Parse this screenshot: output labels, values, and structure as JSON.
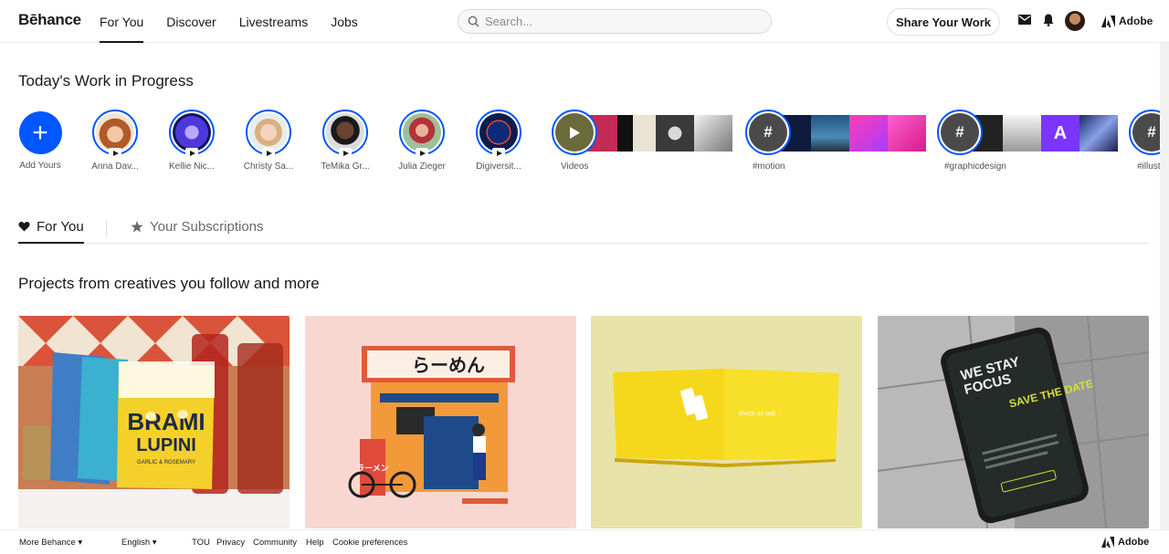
{
  "header": {
    "logo": "Bēhance",
    "nav": [
      "For You",
      "Discover",
      "Livestreams",
      "Jobs"
    ],
    "search_placeholder": "Search...",
    "share_label": "Share Your Work",
    "adobe_label": "Adobe"
  },
  "stories": {
    "title": "Today's Work in Progress",
    "add_label": "Add Yours",
    "people": [
      "Anna Dav...",
      "Kellie Nic...",
      "Christy Sa...",
      "TeMika Gr...",
      "Julia Zieger",
      "Digiversit..."
    ],
    "groups": [
      "Videos",
      "#motion",
      "#graphicdesign",
      "#illustra"
    ]
  },
  "tabs": {
    "for_you": "For You",
    "subscriptions": "Your Subscriptions"
  },
  "projects": {
    "title": "Projects from creatives you follow and more",
    "card1_brand": "BRAMI",
    "card1_product": "LUPINI",
    "card1_sub": "GARLIC & ROSEMARY",
    "card2_sign": "らーめん",
    "card2_banner": "ラーメン",
    "card3_text": "check us out!",
    "card4_line1": "WE STAY",
    "card4_line2": "FOCUS",
    "card4_save": "SAVE THE DATE"
  },
  "footer": {
    "more": "More Behance",
    "language": "English",
    "links": [
      "TOU",
      "Privacy",
      "Community",
      "Help",
      "Cookie preferences"
    ],
    "adobe": "Adobe"
  },
  "colors": {
    "accent": "#0057ff",
    "text": "#191919"
  }
}
